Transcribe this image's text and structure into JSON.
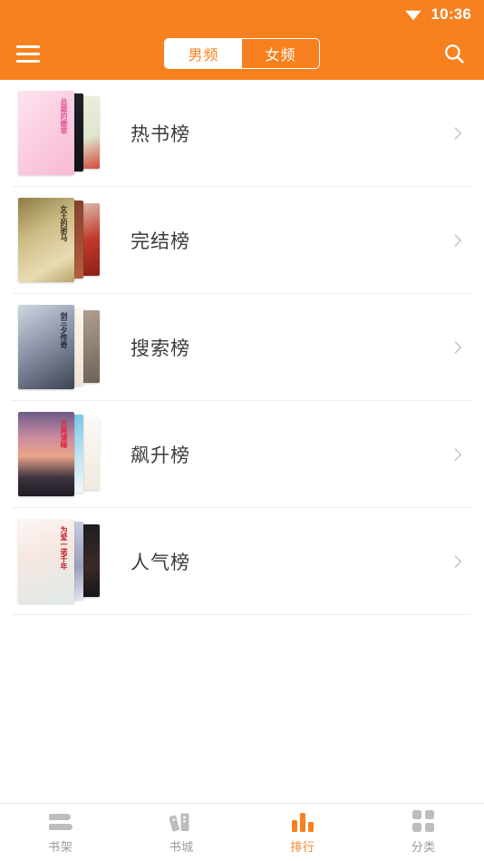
{
  "statusbar": {
    "time": "10:36",
    "wifi_icon": "wifi-icon"
  },
  "appbar": {
    "menu_icon": "hamburger-menu-icon",
    "search_icon": "search-icon",
    "segments": [
      {
        "label": "男频",
        "active": true
      },
      {
        "label": "女频",
        "active": false
      }
    ]
  },
  "colors": {
    "brand_orange": "#f7811f",
    "text_primary": "#3b3b3b",
    "tab_inactive": "#9b9b9b",
    "separator": "#ececec"
  },
  "list": {
    "items": [
      {
        "label": "热书榜",
        "chevron_icon": "chevron-right-icon",
        "covers": {
          "front": {
            "title": "总裁的嫩草",
            "bg": "linear-gradient(135deg,#fde4ef 0%,#fbcfe2 45%,#f8b9d4 100%)",
            "title_color": "#e0559a"
          },
          "mid": {
            "bg": "linear-gradient(160deg,#23242b 0%,#101218 100%)"
          },
          "back": {
            "bg": "linear-gradient(160deg,#eef1e0 0%,#dfe6cf 60%,#d24b3a 100%)"
          }
        }
      },
      {
        "label": "完结榜",
        "chevron_icon": "chevron-right-icon",
        "covers": {
          "front": {
            "title": "女王的驸马",
            "bg": "linear-gradient(150deg,#8d7c46 0%,#cdbd86 40%,#e8dcb4 75%,#b8a468 100%)",
            "title_color": "#3d3422"
          },
          "mid": {
            "bg": "linear-gradient(160deg,#7d3c2c 0%,#b5603f 100%)"
          },
          "back": {
            "bg": "linear-gradient(160deg,#e3d9c8 0%,#c23a2c 55%,#8d2019 100%)"
          }
        }
      },
      {
        "label": "搜索榜",
        "chevron_icon": "chevron-right-icon",
        "covers": {
          "front": {
            "title": "剑三夕传奇",
            "bg": "linear-gradient(150deg,#cfd7e2 0%,#8d96a8 45%,#3b4354 100%)",
            "title_color": "#23283a"
          },
          "mid": {
            "bg": "linear-gradient(160deg,#fdf8f1 0%,#efe4d4 100%)"
          },
          "back": {
            "bg": "linear-gradient(160deg,#b9a795 0%,#6d6258 100%)"
          }
        }
      },
      {
        "label": "飙升榜",
        "chevron_icon": "chevron-right-icon",
        "covers": {
          "front": {
            "title": "天黑请睡",
            "bg": "linear-gradient(180deg,#6d5b87 0%,#c98ba0 30%,#e9a689 52%,#3e3440 78%,#1d1a22 100%)",
            "title_color": "#e0263b"
          },
          "mid": {
            "bg": "linear-gradient(170deg,#6ec4e8 0%,#bfe3f2 55%,#f2f7f9 100%)"
          },
          "back": {
            "bg": "linear-gradient(170deg,#fdfbf6 0%,#f0e9df 100%)"
          }
        }
      },
      {
        "label": "人气榜",
        "chevron_icon": "chevron-right-icon",
        "covers": {
          "front": {
            "title": "为爱一诺千年",
            "bg": "linear-gradient(160deg,#fdf7f4 0%,#f6e7e2 40%,#dfe9e6 100%)",
            "title_color": "#c01f2a"
          },
          "mid": {
            "bg": "linear-gradient(170deg,#cfd2e4 0%,#9aa0bd 60%,#e6e2ee 100%)"
          },
          "back": {
            "bg": "linear-gradient(170deg,#1b1b1d 0%,#3a2a28 60%,#141416 100%)"
          }
        }
      }
    ]
  },
  "tabbar": {
    "items": [
      {
        "label": "书架",
        "icon": "bookshelf-icon",
        "active": false
      },
      {
        "label": "书城",
        "icon": "bookstore-icon",
        "active": false
      },
      {
        "label": "排行",
        "icon": "ranking-bars-icon",
        "active": true
      },
      {
        "label": "分类",
        "icon": "category-grid-icon",
        "active": false
      }
    ]
  }
}
